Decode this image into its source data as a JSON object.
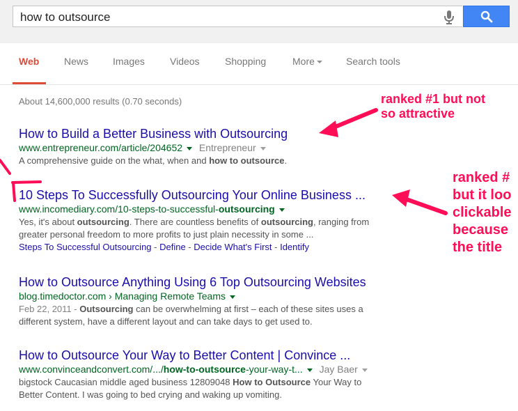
{
  "search": {
    "query": "how to outsource"
  },
  "tabs": [
    {
      "label": "Web"
    },
    {
      "label": "News"
    },
    {
      "label": "Images"
    },
    {
      "label": "Videos"
    },
    {
      "label": "Shopping"
    },
    {
      "label": "More"
    },
    {
      "label": "Search tools"
    }
  ],
  "stats": "About 14,600,000 results (0.70 seconds)",
  "results": [
    {
      "title": "How to Build a Better Business with Outsourcing",
      "url": "www.entrepreneur.com/article/204652",
      "source": "Entrepreneur",
      "snippet_pre": "A comprehensive guide on the what, when and ",
      "snippet_bold": "how to outsource",
      "snippet_post": "."
    },
    {
      "title": "10 Steps To Successfully Outsourcing Your Online Business ...",
      "url_pre": "www.incomediary.com/10-steps-to-successful-",
      "url_bold": "outsourcing",
      "snippet_l1_a": "Yes, it's about ",
      "snippet_l1_b": "outsourcing",
      "snippet_l1_c": ". There are countless benefits of ",
      "snippet_l1_d": "outsourcing",
      "snippet_l1_e": ", ranging from",
      "snippet_l2": "greater personal freedom to more profits to just plain necessity in some ...",
      "links": [
        "Steps To Successful Outsourcing",
        "Define",
        "Decide What's First",
        "Identify"
      ],
      "link_sep": " - "
    },
    {
      "title": "How to Outsource Anything Using 6 Top Outsourcing Websites",
      "url": "blog.timedoctor.com › Managing Remote Teams",
      "date": "Feb 22, 2011 - ",
      "snippet_bold": "Outsourcing",
      "snippet_l1": " can be overwhelming at first – each of these sites uses a",
      "snippet_l2": "different system, have a different layout and can take days to get used to."
    },
    {
      "title": "How to Outsource Your Way to Better Content | Convince ...",
      "url_pre": "www.convinceandconvert.com/.../",
      "url_bold": "how-to-outsource",
      "url_post": "-your-way-t...",
      "source": "Jay Baer",
      "snippet_l1_a": "bigstock Caucasian middle aged business 12809048 ",
      "snippet_l1_b": "How to Outsource",
      "snippet_l1_c": " Your Way to",
      "snippet_l2": "Better Content. I was going to bed crying and waking up vomiting."
    }
  ],
  "annotations": {
    "a1": [
      "ranked #1 but not",
      "so attractive"
    ],
    "a2": [
      "ranked #",
      "but it loo",
      "clickable",
      "because",
      "the title"
    ],
    "color": "#ff0d57"
  },
  "colors": {
    "accent": "#dd4b39",
    "link": "#1a0dab",
    "url": "#006621",
    "button": "#4285f4"
  },
  "icons": {
    "mic": "microphone-icon",
    "search": "magnifier-icon"
  }
}
